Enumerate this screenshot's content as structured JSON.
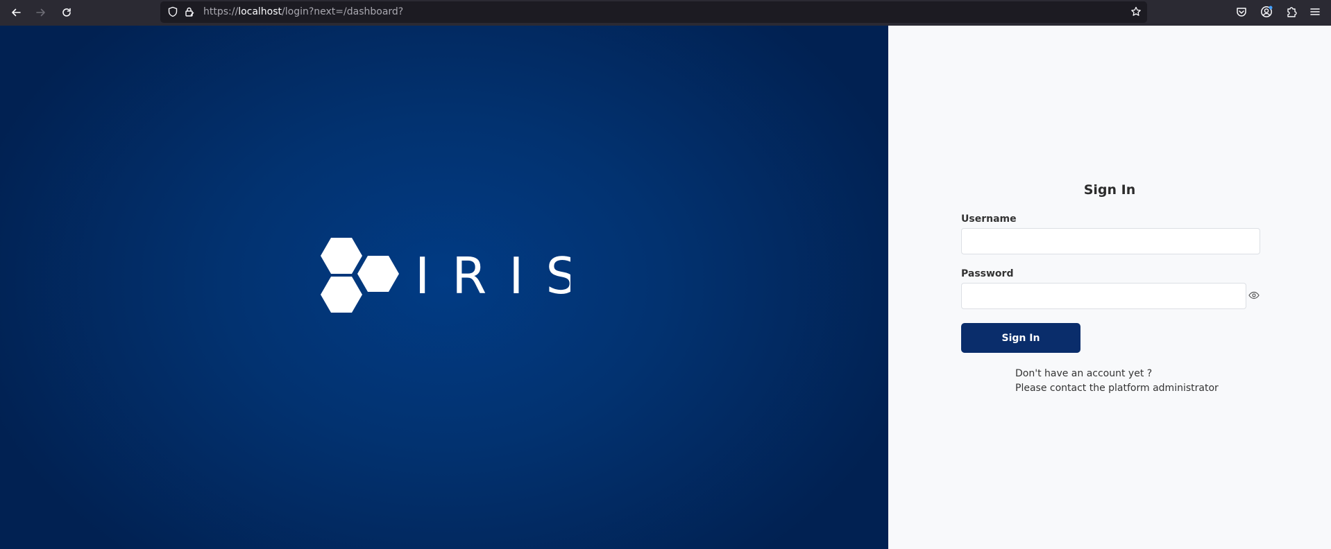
{
  "browser": {
    "url_prefix": "https://",
    "url_host": "localhost",
    "url_path": "/login?next=/dashboard?"
  },
  "hero": {
    "logo_text": "IRIS",
    "background_color": "#023270"
  },
  "form": {
    "title": "Sign In",
    "username_label": "Username",
    "username_value": "",
    "password_label": "Password",
    "password_value": "",
    "submit_label": "Sign In",
    "no_account_text": "Don't have an account yet ?",
    "contact_text": "Please contact the platform administrator",
    "button_color": "#0a2d6b"
  }
}
